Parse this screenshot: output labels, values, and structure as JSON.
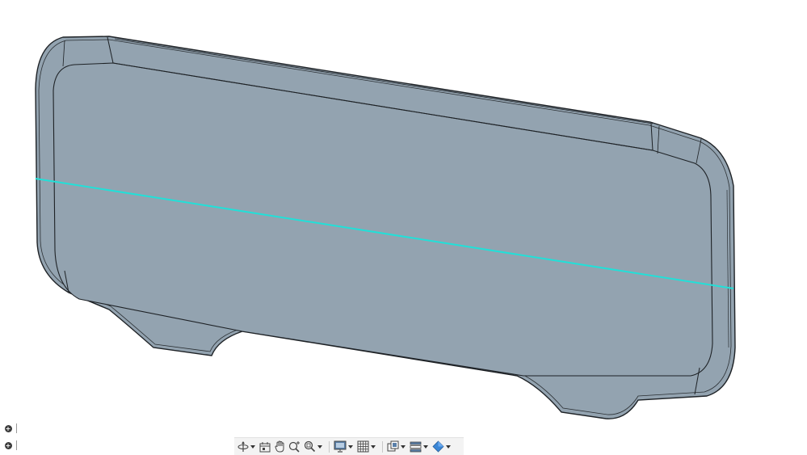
{
  "viewport": {
    "model_fill": "#93a3b0",
    "model_edge": "#1e2226",
    "highlight_color": "#21e0d8",
    "background": "#ffffff"
  },
  "side_buttons": [
    {
      "name": "expand-browser-1",
      "icon": "plus-circle-icon"
    },
    {
      "name": "expand-browser-2",
      "icon": "plus-circle-icon"
    }
  ],
  "toolbar": {
    "tools": [
      {
        "name": "orbit",
        "icon": "orbit-icon",
        "has_menu": true
      },
      {
        "name": "look-at",
        "icon": "look-at-icon",
        "has_menu": false
      },
      {
        "name": "pan",
        "icon": "hand-icon",
        "has_menu": false
      },
      {
        "name": "zoom",
        "icon": "zoom-icon",
        "has_menu": false
      },
      {
        "name": "fit",
        "icon": "zoom-window-icon",
        "has_menu": true
      },
      {
        "name": "display-settings",
        "icon": "monitor-icon",
        "has_menu": true
      },
      {
        "name": "grid-settings",
        "icon": "grid-icon",
        "has_menu": true
      },
      {
        "name": "viewports",
        "icon": "viewports-icon",
        "has_menu": true
      },
      {
        "name": "effects",
        "icon": "layers-icon",
        "has_menu": true
      },
      {
        "name": "visual-style",
        "icon": "cube-icon",
        "has_menu": true
      }
    ]
  }
}
